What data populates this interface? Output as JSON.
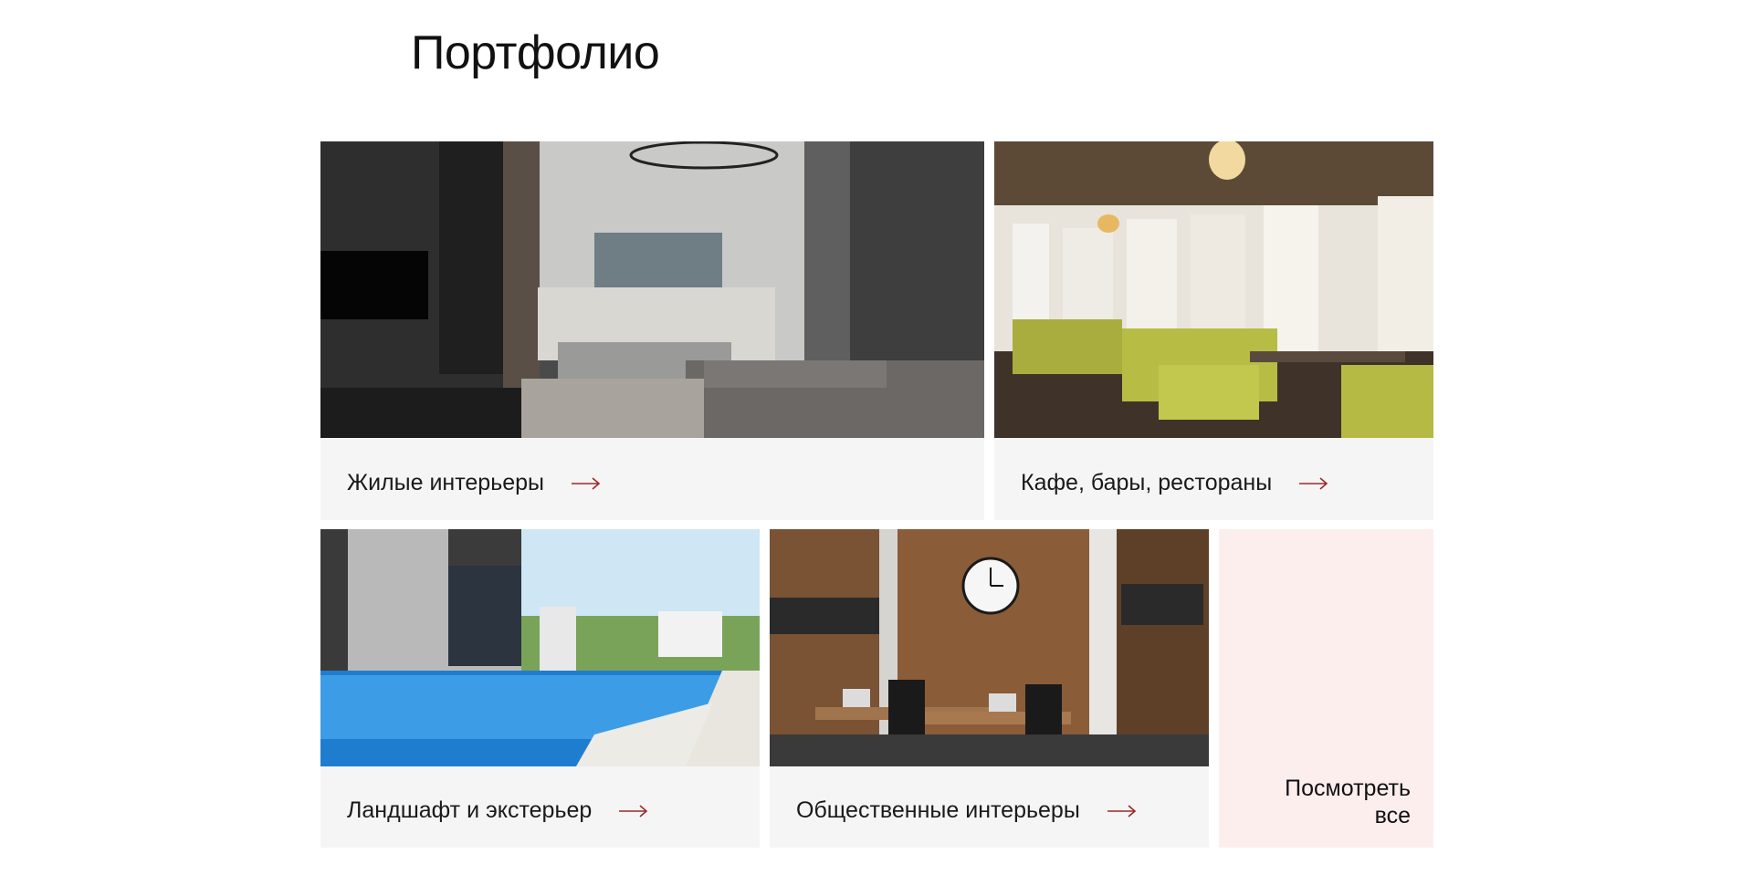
{
  "page": {
    "title": "Портфолио"
  },
  "cards": [
    {
      "id": "living",
      "label": "Жилые интерьеры",
      "image": "modern-living-room-photo"
    },
    {
      "id": "cafe",
      "label": "Кафе, бары, рестораны",
      "image": "restaurant-interior-photo"
    },
    {
      "id": "landscape",
      "label": "Ландшафт и экстерьер",
      "image": "pool-exterior-photo"
    },
    {
      "id": "public",
      "label": "Общественные интерьеры",
      "image": "office-interior-photo"
    }
  ],
  "view_all": {
    "label": "Посмотреть все"
  },
  "icons": {
    "card_arrow": "arrow-right-icon"
  },
  "colors": {
    "arrow": "#9b2a2a",
    "card_bg": "#f5f5f5",
    "view_all_bg": "#fdeeee"
  }
}
